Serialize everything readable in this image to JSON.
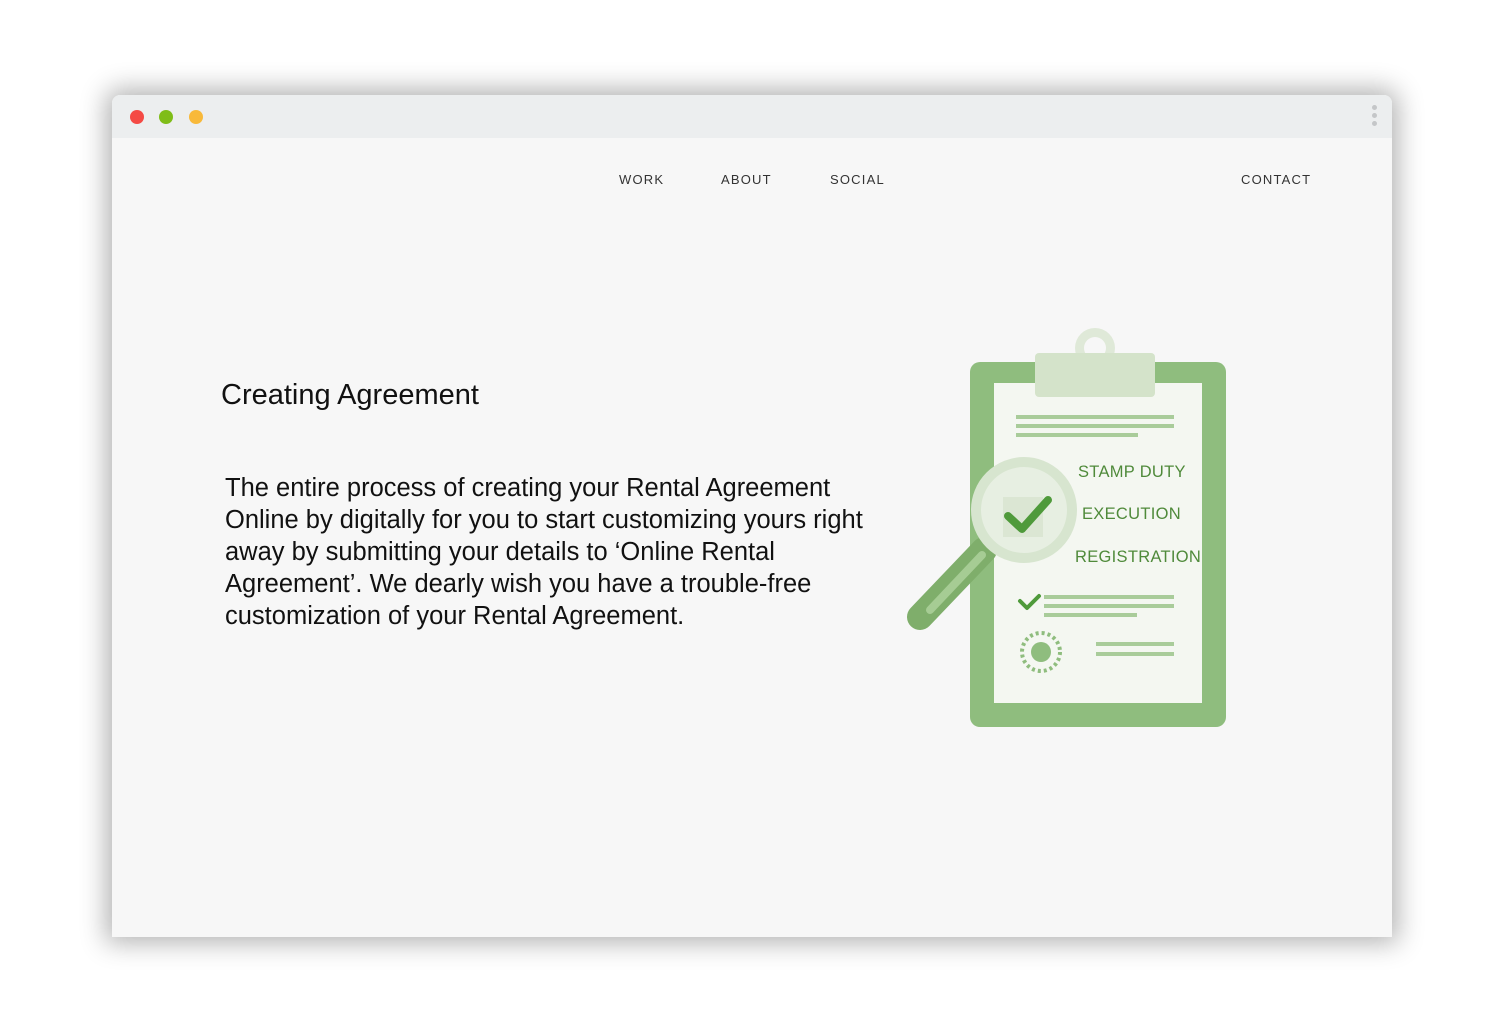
{
  "nav": {
    "items": [
      {
        "label": "WORK"
      },
      {
        "label": "ABOUT"
      },
      {
        "label": "SOCIAL"
      }
    ],
    "contact": "CONTACT"
  },
  "content": {
    "heading": "Creating Agreement",
    "body": "The entire process of creating your Rental Agreement Online by digitally for you to start customizing yours right away by submitting your details to ‘Online Rental Agreement’. We dearly wish you have a trouble-free customization of your Rental Agreement."
  },
  "illustration": {
    "labels": [
      "STAMP DUTY",
      "EXECUTION",
      "REGISTRATION"
    ],
    "icon": "clipboard-checklist-magnifier",
    "colors": {
      "primary": "#8fbd7e",
      "light": "#dde9d5",
      "dark": "#4f8a3a",
      "check": "#4f9a3b"
    }
  },
  "window_controls": {
    "colors": {
      "close": "#f44a45",
      "maximize": "#7fbd18",
      "minimize": "#f8b93a"
    }
  }
}
